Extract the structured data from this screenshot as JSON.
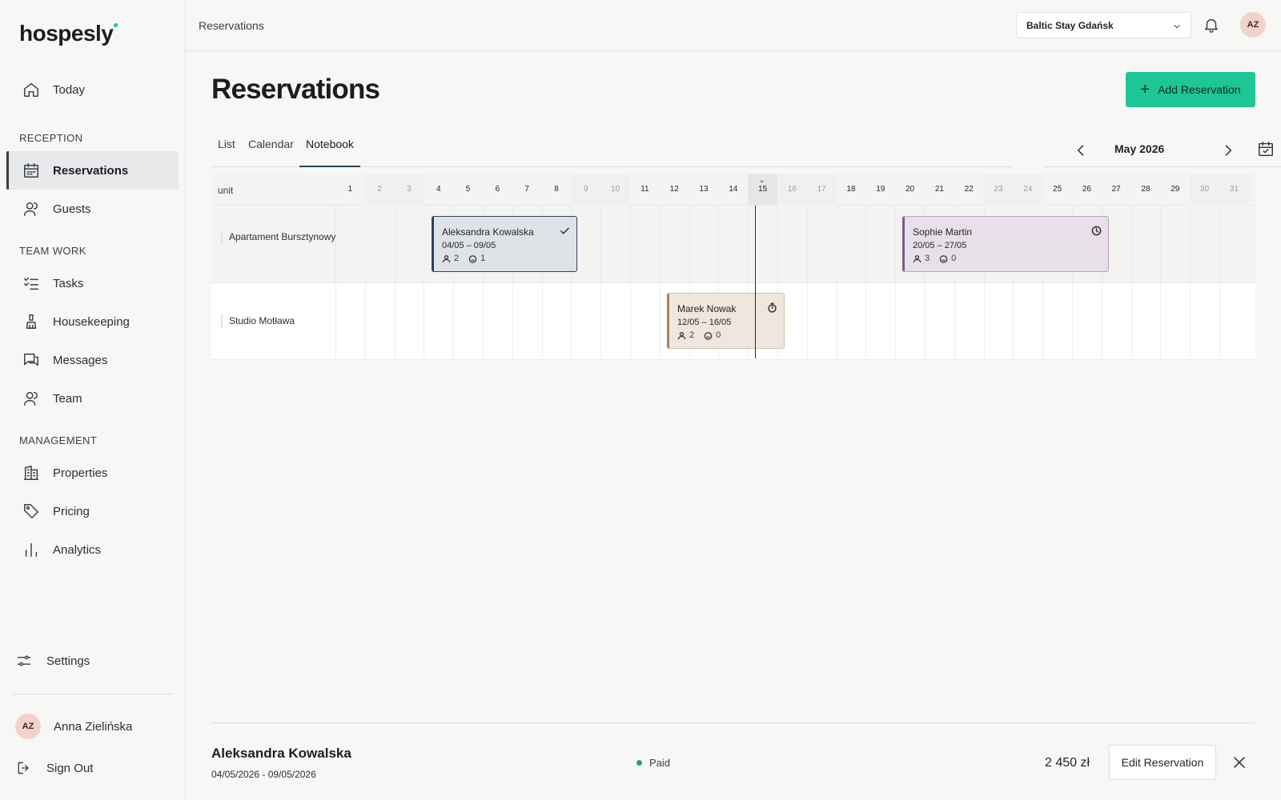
{
  "app": {
    "logo": "hospesly"
  },
  "sidebar": {
    "top_item": {
      "label": "Today",
      "icon": "home-icon"
    },
    "sections": [
      {
        "title": "RECEPTION",
        "items": [
          {
            "label": "Reservations",
            "icon": "calendar-grid-icon",
            "active": true
          },
          {
            "label": "Guests",
            "icon": "users-icon"
          }
        ]
      },
      {
        "title": "TEAM WORK",
        "items": [
          {
            "label": "Tasks",
            "icon": "checklist-icon"
          },
          {
            "label": "Housekeeping",
            "icon": "broom-icon"
          },
          {
            "label": "Messages",
            "icon": "chat-icon"
          },
          {
            "label": "Team",
            "icon": "users-icon"
          }
        ]
      },
      {
        "title": "MANAGEMENT",
        "items": [
          {
            "label": "Properties",
            "icon": "building-icon"
          },
          {
            "label": "Pricing",
            "icon": "tag-icon"
          },
          {
            "label": "Analytics",
            "icon": "bar-chart-icon"
          }
        ]
      }
    ],
    "settings_label": "Settings",
    "user": {
      "initials": "AZ",
      "name": "Anna Zielińska"
    },
    "signout_label": "Sign Out"
  },
  "topbar": {
    "breadcrumb": "Reservations",
    "property": "Baltic Stay Gdańsk",
    "avatar_initials": "AZ"
  },
  "page": {
    "title": "Reservations",
    "add_button": "Add Reservation",
    "tabs": [
      "List",
      "Calendar",
      "Notebook"
    ],
    "active_tab": "Notebook",
    "month": "May 2026"
  },
  "grid": {
    "unit_header": "unit",
    "days": [
      "1",
      "2",
      "3",
      "4",
      "5",
      "6",
      "7",
      "8",
      "9",
      "10",
      "11",
      "12",
      "13",
      "14",
      "15",
      "16",
      "17",
      "18",
      "19",
      "20",
      "21",
      "22",
      "23",
      "24",
      "25",
      "26",
      "27",
      "28",
      "29",
      "30",
      "31"
    ],
    "weekend_days": [
      "2",
      "3",
      "9",
      "10",
      "16",
      "17",
      "23",
      "24",
      "30",
      "31"
    ],
    "today": "15",
    "units": [
      "Apartament Bursztynowy",
      "Studio Motława"
    ]
  },
  "bookings": [
    {
      "unit": "Apartament Bursztynowy",
      "name": "Aleksandra Kowalska",
      "dates": "04/05 – 09/05",
      "guests": "2",
      "pets": "1",
      "status_icon": "check-icon",
      "color": "#2f4257"
    },
    {
      "unit": "Apartament Bursztynowy",
      "name": "Sophie Martin",
      "dates": "20/05 – 27/05",
      "guests": "3",
      "pets": "0",
      "status_icon": "clock-icon",
      "color": "#7e5a8a"
    },
    {
      "unit": "Studio Motława",
      "name": "Marek Nowak",
      "dates": "12/05 – 16/05",
      "guests": "2",
      "pets": "0",
      "status_icon": "stopwatch-icon",
      "color": "#a9825a"
    }
  ],
  "detail": {
    "name": "Aleksandra Kowalska",
    "dates": "04/05/2026 - 09/05/2026",
    "status": "Paid",
    "price": "2 450 zł",
    "edit_button": "Edit Reservation"
  },
  "colors": {
    "accent": "#1ec595",
    "paid": "#1ea079"
  }
}
